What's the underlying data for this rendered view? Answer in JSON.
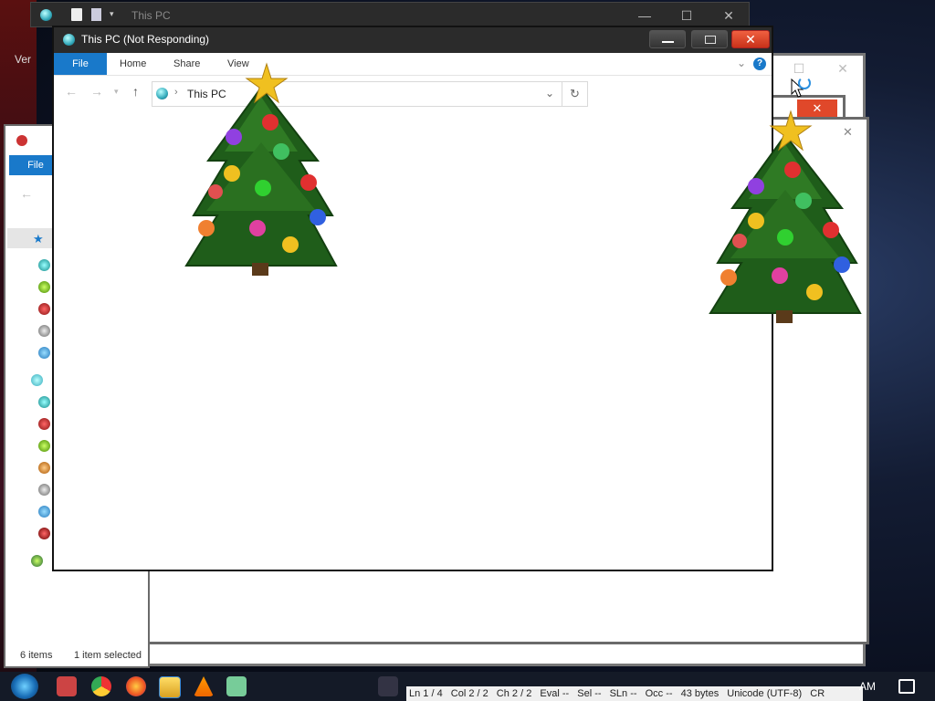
{
  "desktop": {
    "version_text": "Ver"
  },
  "back_window": {
    "title": "This PC"
  },
  "main_window": {
    "title": "This PC (Not Responding)",
    "ribbon_tabs": [
      "File",
      "Home",
      "Share",
      "View"
    ],
    "help_label": "?",
    "address": {
      "path": "This PC"
    }
  },
  "left_window": {
    "file_tab": "File",
    "status_items": "6 items",
    "status_selected": "1 item selected"
  },
  "editor_status": {
    "ln": "Ln 1 / 4",
    "col": "Col 2 / 2",
    "ch": "Ch 2 / 2",
    "eval": "Eval --",
    "sel": "Sel --",
    "sln": "SLn --",
    "occ": "Occ --",
    "bytes": "43 bytes",
    "encoding": "Unicode (UTF-8)",
    "eol": "CR"
  },
  "clock": {
    "time": "AM"
  },
  "colors": {
    "accent": "#1979ca",
    "close": "#e0482a",
    "titlebar": "#2b2b2b"
  }
}
